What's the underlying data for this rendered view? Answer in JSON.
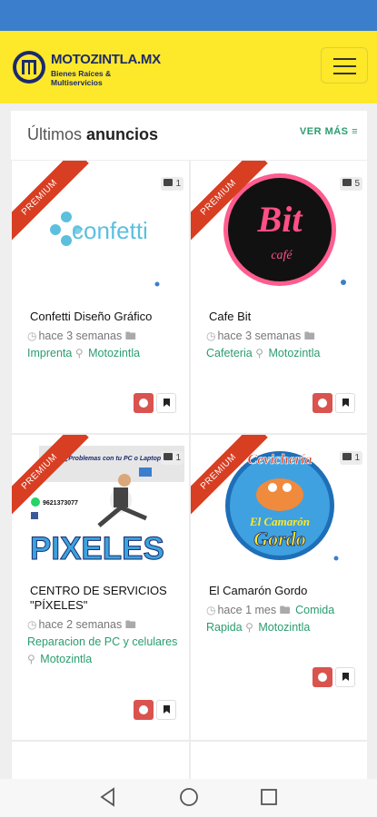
{
  "header": {
    "logo_title": "MOTOZINTLA.MX",
    "logo_subtitle": "Bienes Raíces & Multiservicios"
  },
  "section": {
    "title_light": "Últimos",
    "title_bold": "anuncios",
    "see_more": "VER MÁS"
  },
  "cards": [
    {
      "ribbon": "PREMIUM",
      "photos": "1",
      "image_text": "confetti",
      "title": "Confetti Diseño Gráfico",
      "time": "hace 3 semanas",
      "category": "Imprenta",
      "location": "Motozintla"
    },
    {
      "ribbon": "PREMIUM",
      "photos": "5",
      "image_text": "Bit",
      "image_text2": "café",
      "title": "Cafe Bit",
      "time": "hace 3 semanas",
      "category": "Cafeteria",
      "location": "Motozintla"
    },
    {
      "ribbon": "PREMIUM",
      "photos": "1",
      "image_text": "PIXELES",
      "image_caption": "¿Problemas con tu PC o Laptop?",
      "image_phone": "9621373077",
      "title_line1": "CENTRO DE SERVICIOS",
      "title_line2": "\"PÍXELES\"",
      "time": "hace 2 semanas",
      "category": "Reparacion de PC y celulares",
      "location": "Motozintla"
    },
    {
      "ribbon": "PREMIUM",
      "photos": "1",
      "image_text": "Cevichería",
      "image_text2": "El Camarón",
      "image_text3": "Gordo",
      "title": "El Camarón Gordo",
      "time": "hace 1 mes",
      "category_line1": "Comida",
      "category_line2": "Rapida",
      "location": "Motozintla"
    }
  ],
  "colors": {
    "status_bar": "#3b7fcc",
    "header": "#fde82a",
    "accent_green": "#2a9d6d",
    "ribbon": "#d83e22",
    "favorite": "#d9534f"
  }
}
